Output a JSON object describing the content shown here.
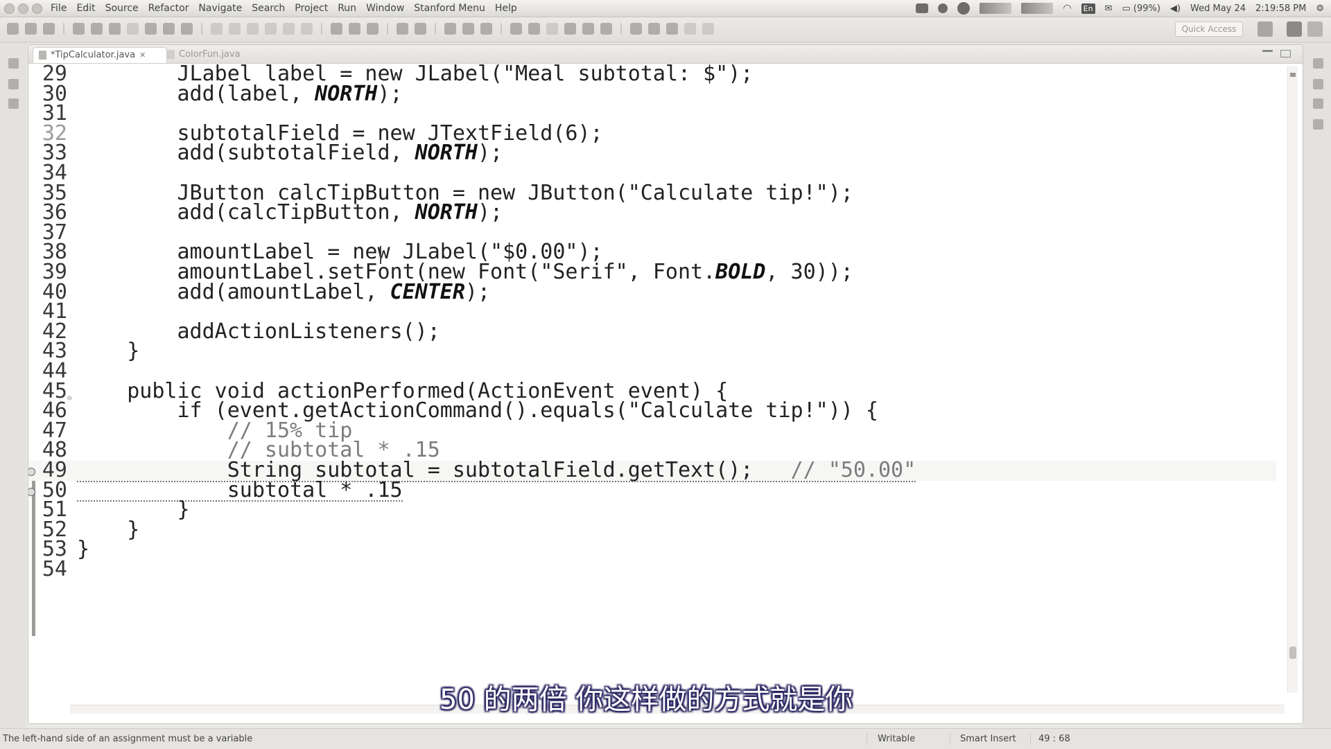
{
  "menubar": {
    "items": [
      "File",
      "Edit",
      "Source",
      "Refactor",
      "Navigate",
      "Search",
      "Project",
      "Run",
      "Window",
      "Stanford Menu",
      "Help"
    ],
    "battery": "(99%)",
    "date": "Wed May 24",
    "time": "2:19:58 PM",
    "keyboard": "En"
  },
  "toolbar": {
    "quick_access_placeholder": "Quick Access"
  },
  "editor": {
    "active_tab": "*TipCalculator.java",
    "inactive_tab": "ColorFun.java",
    "lines": [
      {
        "n": "29",
        "text": "        JLabel label = new JLabel(\"Meal subtotal: $\");"
      },
      {
        "n": "30",
        "text": "        add(label, NORTH);"
      },
      {
        "n": "31",
        "text": ""
      },
      {
        "n": "32",
        "text": "        subtotalField = new JTextField(6);"
      },
      {
        "n": "33",
        "text": "        add(subtotalField, NORTH);"
      },
      {
        "n": "34",
        "text": ""
      },
      {
        "n": "35",
        "text": "        JButton calcTipButton = new JButton(\"Calculate tip!\");"
      },
      {
        "n": "36",
        "text": "        add(calcTipButton, NORTH);"
      },
      {
        "n": "37",
        "text": ""
      },
      {
        "n": "38",
        "text": "        amountLabel = new JLabel(\"$0.00\");"
      },
      {
        "n": "39",
        "text": "        amountLabel.setFont(new Font(\"Serif\", Font.BOLD, 30));"
      },
      {
        "n": "40",
        "text": "        add(amountLabel, CENTER);"
      },
      {
        "n": "41",
        "text": ""
      },
      {
        "n": "42",
        "text": "        addActionListeners();"
      },
      {
        "n": "43",
        "text": "    }"
      },
      {
        "n": "44",
        "text": ""
      },
      {
        "n": "45",
        "text": "    public void actionPerformed(ActionEvent event) {"
      },
      {
        "n": "46",
        "text": "        if (event.getActionCommand().equals(\"Calculate tip!\")) {"
      },
      {
        "n": "47",
        "text": "            // 15% tip"
      },
      {
        "n": "48",
        "text": "            // subtotal * .15"
      },
      {
        "n": "49",
        "text": "            String subtotal = subtotalField.getText();   // \"50.00\""
      },
      {
        "n": "50",
        "text": "            subtotal * .15"
      },
      {
        "n": "51",
        "text": "        }"
      },
      {
        "n": "52",
        "text": "    }"
      },
      {
        "n": "53",
        "text": "}"
      },
      {
        "n": "54",
        "text": ""
      }
    ]
  },
  "subtitle": "50 的两倍 你这样做的方式就是你",
  "status": {
    "message": "The left-hand side of an assignment must be a variable",
    "writable": "Writable",
    "insert_mode": "Smart Insert",
    "position": "49 : 68"
  },
  "colors": {
    "background": "#e9e8e6",
    "editor_bg": "#ffffff",
    "comment": "#7c7c7c",
    "subtitle_outline": "#2a2460"
  }
}
